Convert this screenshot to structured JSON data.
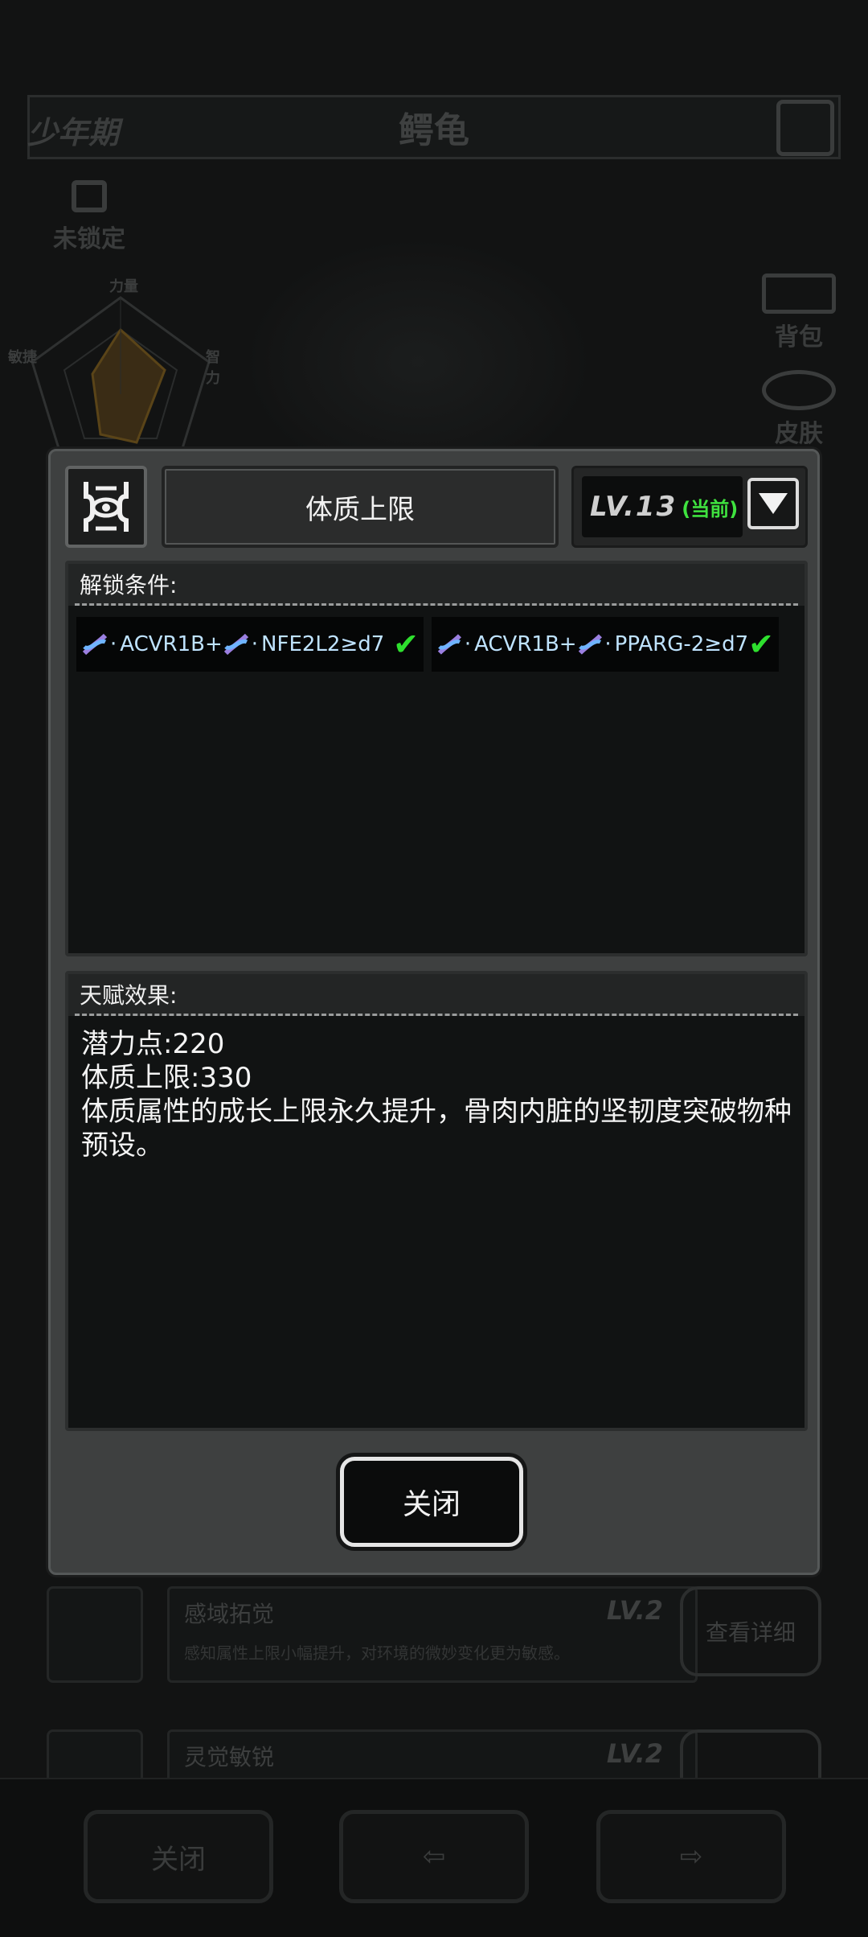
{
  "background": {
    "stage_label": "少年期",
    "creature_name": "鳄龟",
    "lock_label": "未锁定",
    "radar_labels": {
      "top": "力量",
      "left": "敏捷",
      "right": "智力"
    },
    "side_buttons": [
      "背包",
      "皮肤"
    ],
    "rows": [
      {
        "name": "感域拓觉",
        "level": "LV.2",
        "description": "感知属性上限小幅提升，对环境的微妙变化更为敏感。",
        "button": "查看详细"
      },
      {
        "name": "灵觉敏锐",
        "level": "LV.2",
        "description": "",
        "button": ""
      }
    ],
    "bottom_close": "关闭"
  },
  "modal": {
    "title": "体质上限",
    "level_text": "LV.13",
    "current_tag": "(当前)",
    "unlock_section": {
      "header": "解锁条件:",
      "conditions": [
        {
          "gene1": "ACVR1B",
          "gene2": "NFE2L2",
          "op": "+",
          "requirement": "≥d7",
          "met": true
        },
        {
          "gene1": "ACVR1B",
          "gene2": "PPARG-2",
          "op": "+",
          "requirement": "≥d7",
          "met": true
        }
      ]
    },
    "effect_section": {
      "header": "天赋效果:",
      "lines": [
        "潜力点:220",
        "体质上限:330",
        "体质属性的成长上限永久提升，骨肉内脏的坚韧度突破物种预设。"
      ]
    },
    "close_label": "关闭"
  },
  "colors": {
    "check": "#2ee02e",
    "current": "#3fe23f",
    "gene_text": "#bfe3ff"
  }
}
